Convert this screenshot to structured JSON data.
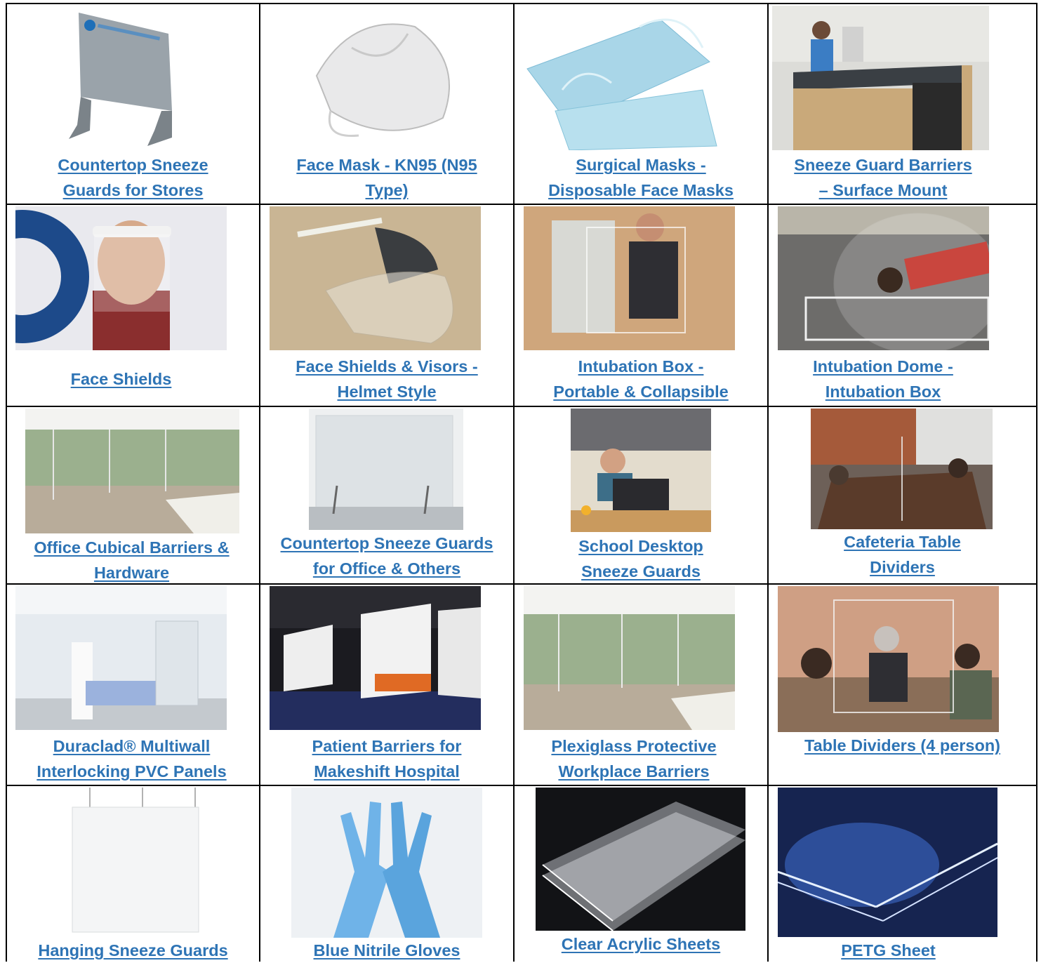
{
  "colors": {
    "link": "#2E74B5",
    "border": "#000000"
  },
  "products": [
    {
      "lines": [
        "Countertop Sneeze",
        "Guards for Stores"
      ],
      "image": "acrylic-sneeze-guard-with-logo"
    },
    {
      "lines": [
        "Face Mask - KN95 (N95",
        "Type)"
      ],
      "image": "white-kn95-mask"
    },
    {
      "lines": [
        "Surgical Masks -",
        "Disposable Face Masks"
      ],
      "image": "blue-surgical-masks"
    },
    {
      "lines": [
        "Sneeze Guard Barriers",
        "– Surface Mount"
      ],
      "image": "reception-desk-with-barrier"
    },
    {
      "lines": [
        "Face Shields"
      ],
      "image": "man-wearing-face-shield"
    },
    {
      "lines": [
        "Face Shields & Visors -",
        "Helmet Style"
      ],
      "image": "helmet-visor"
    },
    {
      "lines": [
        "Intubation Box -",
        "Portable & Collapsible"
      ],
      "image": "person-with-intubation-box"
    },
    {
      "lines": [
        "Intubation Dome -",
        "Intubation Box"
      ],
      "image": "woman-under-acrylic-dome"
    },
    {
      "lines": [
        "Office Cubical Barriers &",
        "Hardware"
      ],
      "image": "office-cubicle-barriers"
    },
    {
      "lines": [
        "Countertop Sneeze Guards",
        "for Office & Others"
      ],
      "image": "clear-countertop-shield"
    },
    {
      "lines": [
        "School Desktop",
        "Sneeze Guards"
      ],
      "image": "student-at-desk-with-shield"
    },
    {
      "lines": [
        "Cafeteria Table",
        "Dividers"
      ],
      "image": "cafeteria-table-dividers"
    },
    {
      "lines": [
        "Duraclad® Multiwall",
        "Interlocking PVC Panels"
      ],
      "image": "hospital-room-pvc-panels"
    },
    {
      "lines": [
        "Patient Barriers for",
        "Makeshift Hospital"
      ],
      "image": "makeshift-hospital-barriers"
    },
    {
      "lines": [
        "Plexiglass Protective",
        "Workplace Barriers"
      ],
      "image": "workplace-plexiglass-barriers"
    },
    {
      "lines": [
        "Table  Dividers (4 person)"
      ],
      "image": "four-person-table-dividers"
    },
    {
      "lines": [
        "Hanging Sneeze Guards"
      ],
      "image": "hanging-sneeze-guard"
    },
    {
      "lines": [
        "Blue Nitrile Gloves"
      ],
      "image": "blue-nitrile-gloves"
    },
    {
      "lines": [
        "Clear Acrylic Sheets"
      ],
      "image": "stacked-acrylic-sheets"
    },
    {
      "lines": [
        "PETG Sheet"
      ],
      "image": "petg-sheets-on-blue"
    }
  ]
}
